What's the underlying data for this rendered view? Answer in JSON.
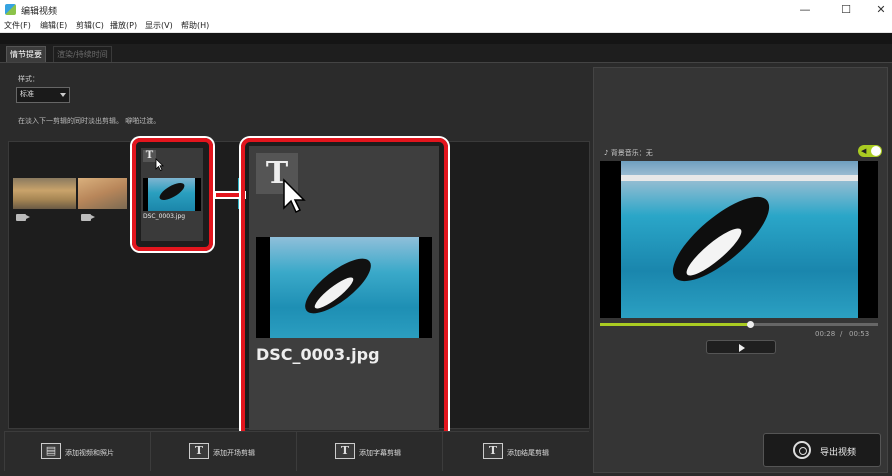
{
  "window": {
    "title": "编辑视频",
    "controls": [
      "—",
      "☐",
      "✕"
    ]
  },
  "menu": [
    "文件(F)",
    "编辑(E)",
    "剪辑(C)",
    "播放(P)",
    "显示(V)",
    "帮助(H)"
  ],
  "tabs": [
    "情节提要",
    "渲染/持续时间"
  ],
  "style": {
    "label": "样式：",
    "value": "标准",
    "hint": "在淡入下一剪辑的同时淡出剪辑。 噼啪过渡。"
  },
  "clip": {
    "small_name": "DSC_0003.jpg",
    "big_name": "DSC_0003.jpg",
    "title_glyph": "T"
  },
  "toolbar": [
    "添加视频和照片",
    "添加开场剪辑",
    "添加字幕剪辑",
    "添加结尾剪辑"
  ],
  "player": {
    "bgm": "♪ 背景音乐：无",
    "current": "00:28",
    "separator": "/",
    "total": "00:53",
    "progress": 0.54
  },
  "export_label": "导出视频",
  "colors": {
    "highlight": "#e3151d",
    "accent": "#aacc22"
  },
  "icons": {
    "cursor": "arrow-cursor-icon",
    "play": "play-icon",
    "export": "film-reel-icon",
    "speaker": "speaker-icon"
  }
}
